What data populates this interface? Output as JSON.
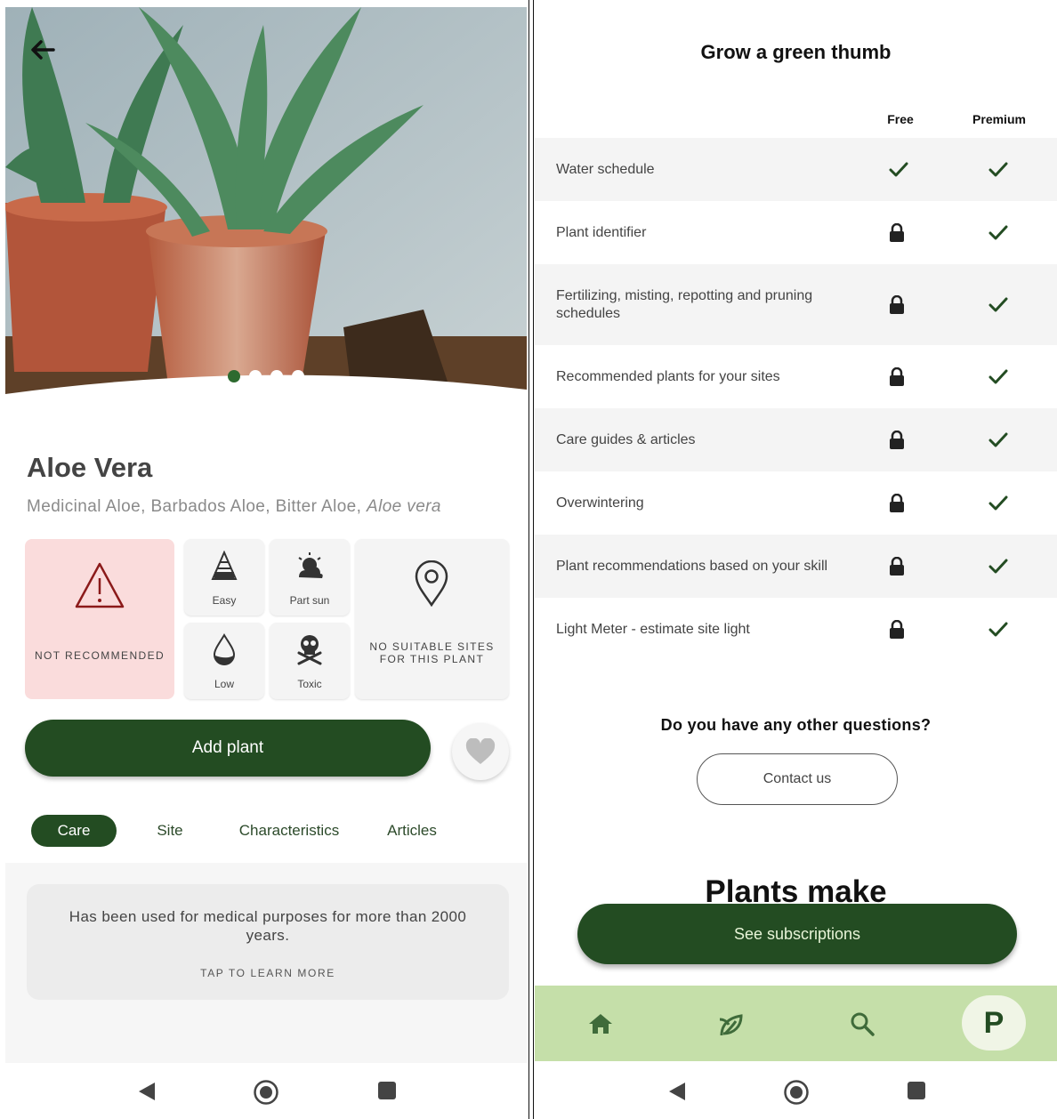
{
  "left": {
    "plant": {
      "name": "Aloe Vera",
      "common_names": "Medicinal Aloe,  Barbados Aloe,  Bitter Aloe,",
      "latin_name": "Aloe vera"
    },
    "carousel": {
      "total": 4,
      "active": 1
    },
    "warning": {
      "label": "NOT RECOMMENDED",
      "icon": "warning-triangle-icon"
    },
    "attributes": [
      {
        "label": "Easy",
        "icon": "difficulty-pyramid-icon"
      },
      {
        "label": "Part sun",
        "icon": "part-sun-icon"
      },
      {
        "label": "Low",
        "icon": "water-drop-icon"
      },
      {
        "label": "Toxic",
        "icon": "skull-crossbones-icon"
      }
    ],
    "sites": {
      "label": "NO SUITABLE SITES FOR THIS PLANT",
      "icon": "location-pin-icon"
    },
    "add_button": "Add plant",
    "tabs": [
      "Care",
      "Site",
      "Characteristics",
      "Articles"
    ],
    "active_tab": "Care",
    "fact": {
      "text": "Has been used for medical purposes for more than 2000 years.",
      "cta": "TAP TO LEARN MORE"
    },
    "colors": {
      "primary": "#234c22",
      "warning_bg": "#fadcdc",
      "warning_icon": "#8b1a1a"
    }
  },
  "right": {
    "title": "Grow a green thumb",
    "columns": [
      "Free",
      "Premium"
    ],
    "features": [
      {
        "name": "Water schedule",
        "free": "check",
        "premium": "check"
      },
      {
        "name": "Plant identifier",
        "free": "lock",
        "premium": "check"
      },
      {
        "name": "Fertilizing, misting, repotting and pruning schedules",
        "free": "lock",
        "premium": "check"
      },
      {
        "name": "Recommended plants for your sites",
        "free": "lock",
        "premium": "check"
      },
      {
        "name": "Care guides & articles",
        "free": "lock",
        "premium": "check"
      },
      {
        "name": "Overwintering",
        "free": "lock",
        "premium": "check"
      },
      {
        "name": "Plant recommendations based on your skill",
        "free": "lock",
        "premium": "check"
      },
      {
        "name": "Light Meter - estimate site light",
        "free": "lock",
        "premium": "check"
      }
    ],
    "question": "Do you have any other questions?",
    "contact_button": "Contact us",
    "promo_heading": "Plants make",
    "subscribe_button": "See subscriptions",
    "bottom_nav": [
      "home-icon",
      "plant-leaf-icon",
      "search-icon",
      "profile-icon"
    ],
    "profile_letter": "P",
    "colors": {
      "primary": "#234c22",
      "nav_bg": "#c5dfa9"
    }
  }
}
